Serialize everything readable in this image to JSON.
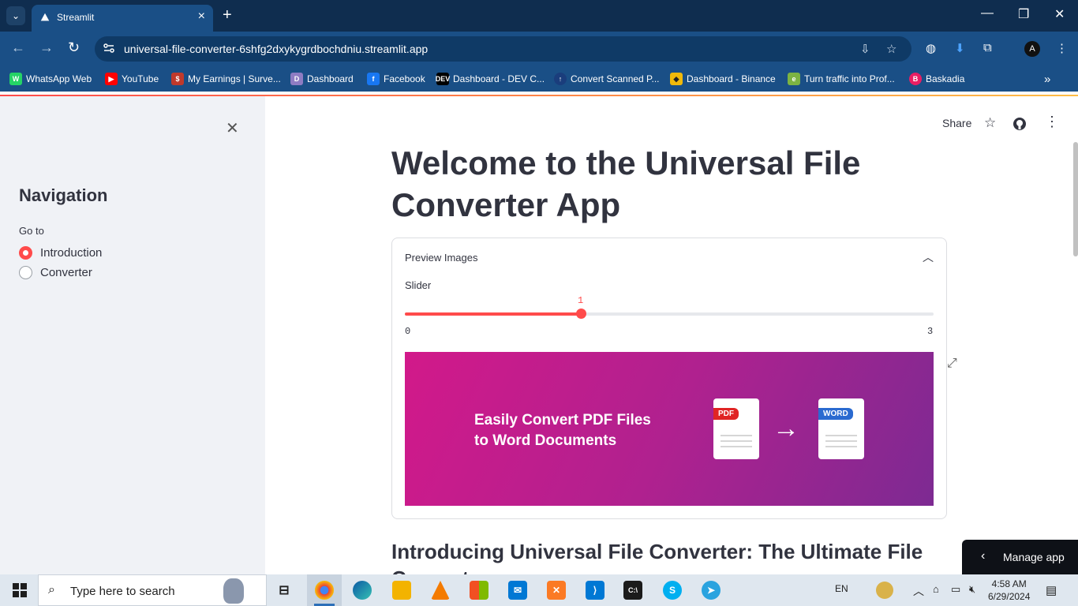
{
  "browser": {
    "tab_title": "Streamlit",
    "url": "universal-file-converter-6shfg2dxykygrdbochdniu.streamlit.app",
    "bookmarks": [
      {
        "label": "WhatsApp Web",
        "icon": "whatsapp-icon",
        "color": "#25d366"
      },
      {
        "label": "YouTube",
        "icon": "youtube-icon",
        "color": "#ff0000"
      },
      {
        "label": "My Earnings | Surve...",
        "icon": "earnings-icon",
        "color": "#c0392b"
      },
      {
        "label": "Dashboard",
        "icon": "dashboard-icon",
        "color": "#8e7cc3"
      },
      {
        "label": "Facebook",
        "icon": "facebook-icon",
        "color": "#1877f2"
      },
      {
        "label": "Dashboard - DEV C...",
        "icon": "dev-icon",
        "color": "#000000"
      },
      {
        "label": "Convert Scanned P...",
        "icon": "convert-icon",
        "color": "#1a3d7c"
      },
      {
        "label": "Dashboard - Binance",
        "icon": "binance-icon",
        "color": "#f0b90b"
      },
      {
        "label": "Turn traffic into Prof...",
        "icon": "traffic-icon",
        "color": "#7cb342"
      },
      {
        "label": "Baskadia",
        "icon": "baskadia-icon",
        "color": "#e91e63"
      }
    ]
  },
  "sidebar": {
    "title": "Navigation",
    "radio_label": "Go to",
    "options": [
      {
        "label": "Introduction",
        "selected": true
      },
      {
        "label": "Converter",
        "selected": false
      }
    ]
  },
  "header": {
    "share_label": "Share"
  },
  "main": {
    "title": "Welcome to the Universal File Converter App",
    "expander_label": "Preview Images",
    "slider": {
      "label": "Slider",
      "value": "1",
      "min": "0",
      "max": "3",
      "value_num": 1,
      "min_num": 0,
      "max_num": 3
    },
    "banner": {
      "line1": "Easily Convert PDF Files",
      "line2": "to Word Documents",
      "pdf_tag": "PDF",
      "word_tag": "WORD"
    },
    "subtitle": "Introducing Universal File Converter: The Ultimate File Converter",
    "manage_app": "Manage app"
  },
  "taskbar": {
    "search_placeholder": "Type here to search",
    "language": "EN",
    "time": "4:58 AM",
    "date": "6/29/2024"
  },
  "colors": {
    "accent": "#ff4b4b",
    "sidebar_bg": "#f0f2f6",
    "chrome_dark": "#0f2d4f",
    "chrome": "#1a4f86"
  }
}
